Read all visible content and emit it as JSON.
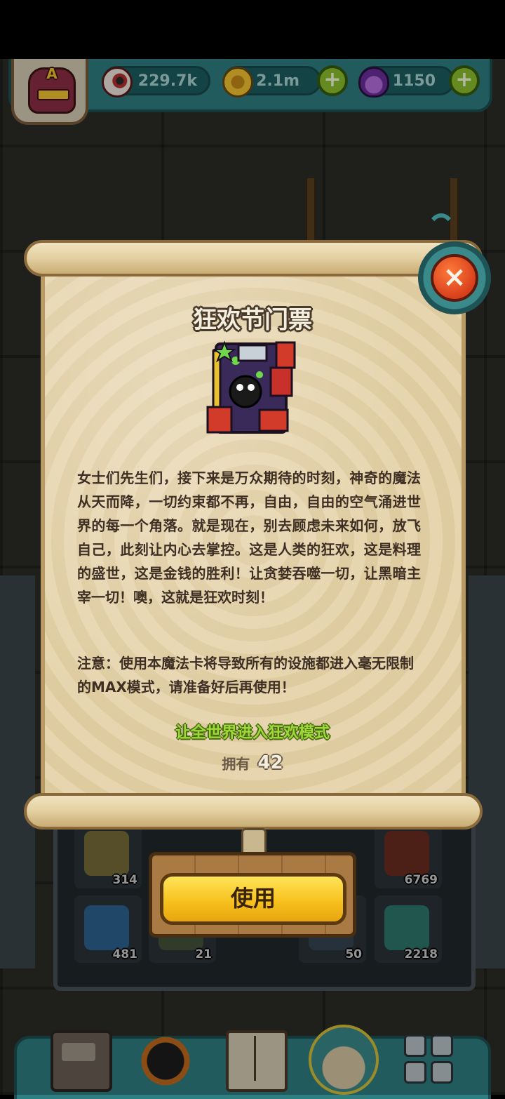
{
  "hud": {
    "eyes": "229.7k",
    "coins": "2.1m",
    "potions": "1150",
    "avatar_letter": "A",
    "plus_label": "+"
  },
  "dialog": {
    "title": "狂欢节门票",
    "item_icon": "carnival-ticket-icon",
    "description": "女士们先生们，接下来是万众期待的时刻，神奇的魔法从天而降，一切约束都不再，自由，自由的空气涌进世界的每一个角落。就是现在，别去顾虑未来如何，放飞自己，此刻让内心去掌控。这是人类的狂欢，这是料理的盛世，这是金钱的胜利！让贪婪吞噬一切，让黑暗主宰一切！噢，这就是狂欢时刻！",
    "note": "注意：使用本魔法卡将导致所有的设施都进入毫无限制的MAX模式，请准备好后再使用！",
    "effect": "让全世界进入狂欢模式",
    "owned_label": "拥有",
    "owned_count": "42",
    "use_label": "使用",
    "close_label": "×"
  },
  "inventory": {
    "counts": [
      "314",
      "6769",
      "481",
      "21",
      "50",
      "2218"
    ]
  },
  "colors": {
    "hud_teal": "#2f7f82",
    "parchment": "#e6d5ae",
    "button_yellow": "#f7c21e",
    "close_orange": "#d8401c",
    "effect_green": "#9ed83a"
  },
  "nav": {
    "items": [
      "shop-icon",
      "monster-icon",
      "book-icon",
      "bag-icon",
      "grid-icon"
    ]
  }
}
